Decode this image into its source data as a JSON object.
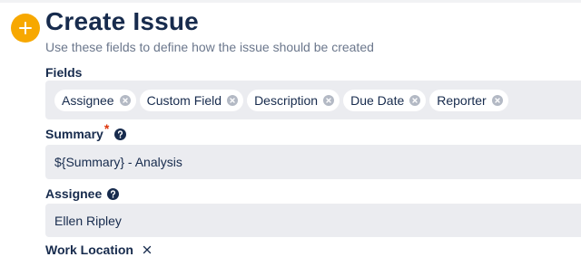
{
  "header": {
    "title": "Create Issue",
    "subtitle": "Use these fields to define how the issue should be created",
    "add_icon": "plus-icon",
    "accent_color": "#f7a800"
  },
  "fields_section": {
    "label": "Fields",
    "tags": [
      "Assignee",
      "Custom Field",
      "Description",
      "Due Date",
      "Reporter"
    ],
    "tag_remove_icon": "close-circle-icon"
  },
  "summary": {
    "label": "Summary",
    "required_marker": "*",
    "help_icon": "question-circle-icon",
    "value": "${Summary} - Analysis"
  },
  "assignee": {
    "label": "Assignee",
    "help_icon": "question-circle-icon",
    "value": "Ellen Ripley"
  },
  "work_location": {
    "label": "Work Location",
    "remove_icon": "close-icon"
  }
}
